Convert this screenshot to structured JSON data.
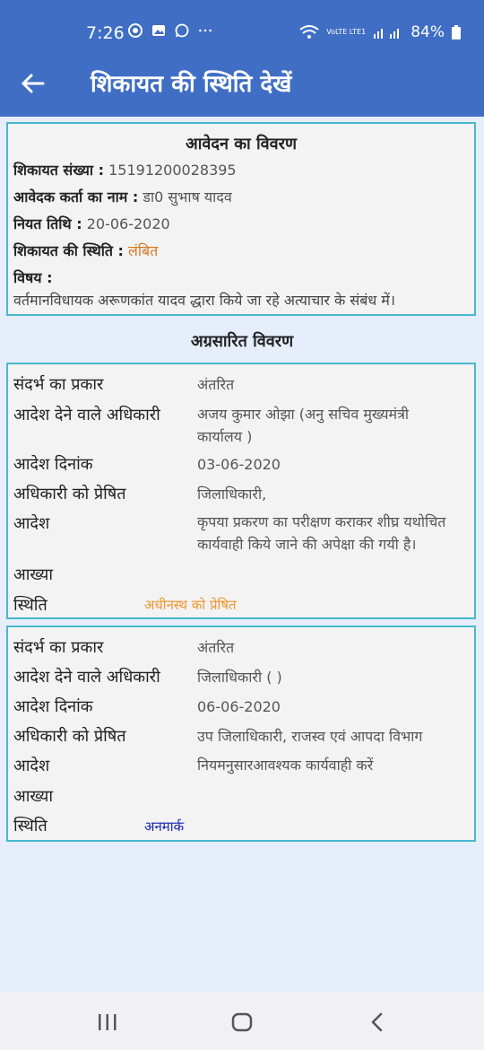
{
  "status_bar": {
    "time": "7:26",
    "icons": [
      "chrome-icon",
      "gallery-icon",
      "whatsapp-icon",
      "more-icon"
    ],
    "network": "VoLTE LTE1",
    "battery": "84%"
  },
  "app_bar": {
    "title": "शिकायत की स्थिति देखें"
  },
  "application": {
    "heading": "आवेदन का विवरण",
    "complaint_no_label": "शिकायत संख्या :",
    "complaint_no_value": "15191200028395",
    "applicant_label": "आवेदक कर्ता का नाम :",
    "applicant_value": "डा0 सुभाष यादव",
    "date_label": "नियत तिथि :",
    "date_value": "20-06-2020",
    "status_label": "शिकायत की स्थिति :",
    "status_value": "लंबित",
    "subject_label": "विषय :",
    "subject_value": "वर्तमानविधायक अरूणकांत यादव द्धारा किये जा रहे अत्याचार के संबंध में।"
  },
  "forwarded": {
    "heading": "अग्रसारित विवरण",
    "labels": {
      "type": "संदर्भ का प्रकार",
      "officer": "आदेश देने वाले अधिकारी",
      "date": "आदेश दिनांक",
      "sent_to": "अधिकारी को प्रेषित",
      "order": "आदेश",
      "remark": "आख्या",
      "status": "स्थिति"
    },
    "entries": [
      {
        "type": "अंतरित",
        "officer_line1": "अजय कुमार ओझा (अनु सचिव मुख्यमंत्री",
        "officer_line2": "कार्यालय )",
        "date": "03-06-2020",
        "sent_to": "जिलाधिकारी,",
        "order_line1": "कृपया प्रकरण का परीक्षण कराकर शीघ्र यथोचित",
        "order_line2": "कार्यवाही किये जाने की अपेक्षा की गयी है।",
        "remark": "",
        "status": "अधीनस्थ को प्रेषित"
      },
      {
        "type": "अंतरित",
        "officer_line1": "जिलाधिकारी ( )",
        "date": "06-06-2020",
        "sent_to": "उप जिलाधिकारी, राजस्व एवं आपदा  विभाग",
        "order_line1": "नियमनुसारआवश्यक कार्यवाही करें",
        "remark": "",
        "status": "अनमार्क"
      }
    ]
  },
  "colors": {
    "app_bar": "#3f6ec4",
    "background": "#e6eefb",
    "card_border": "#47b8cf",
    "pending": "#d4781f",
    "forwarded_status": "#f0962e",
    "unmarked_status": "#1a20b6"
  }
}
